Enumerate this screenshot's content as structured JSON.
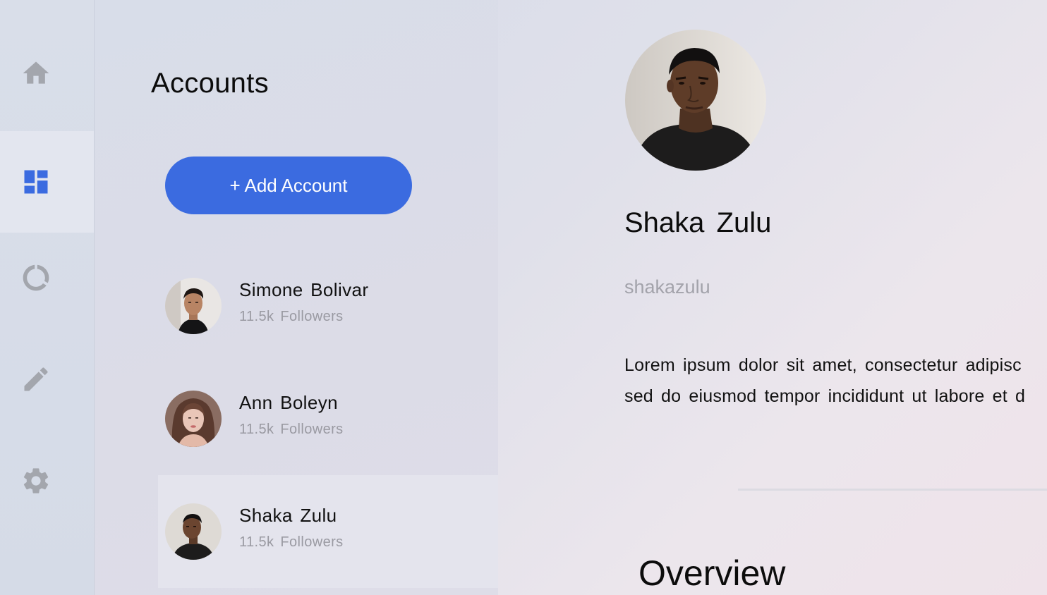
{
  "rail": {
    "items": [
      {
        "icon": "home-icon"
      },
      {
        "icon": "dashboard-icon",
        "active": true
      },
      {
        "icon": "chart-ring-icon"
      },
      {
        "icon": "edit-icon"
      },
      {
        "icon": "settings-icon"
      }
    ],
    "accent_color": "#3b6be0",
    "icon_color": "#a3a6ad"
  },
  "accounts": {
    "title": "Accounts",
    "add_button_label": "+ Add Account",
    "list": [
      {
        "name": "Simone Bolivar",
        "followers": "11.5k Followers"
      },
      {
        "name": "Ann Boleyn",
        "followers": "11.5k Followers"
      },
      {
        "name": "Shaka Zulu",
        "followers": "11.5k Followers",
        "selected": true
      }
    ]
  },
  "detail": {
    "name": "Shaka Zulu",
    "handle": "shakazulu",
    "bio_line1": "Lorem ipsum dolor sit amet, consectetur adipisc",
    "bio_line2": "sed do eiusmod tempor incididunt ut labore et d",
    "section_title": "Overview"
  }
}
